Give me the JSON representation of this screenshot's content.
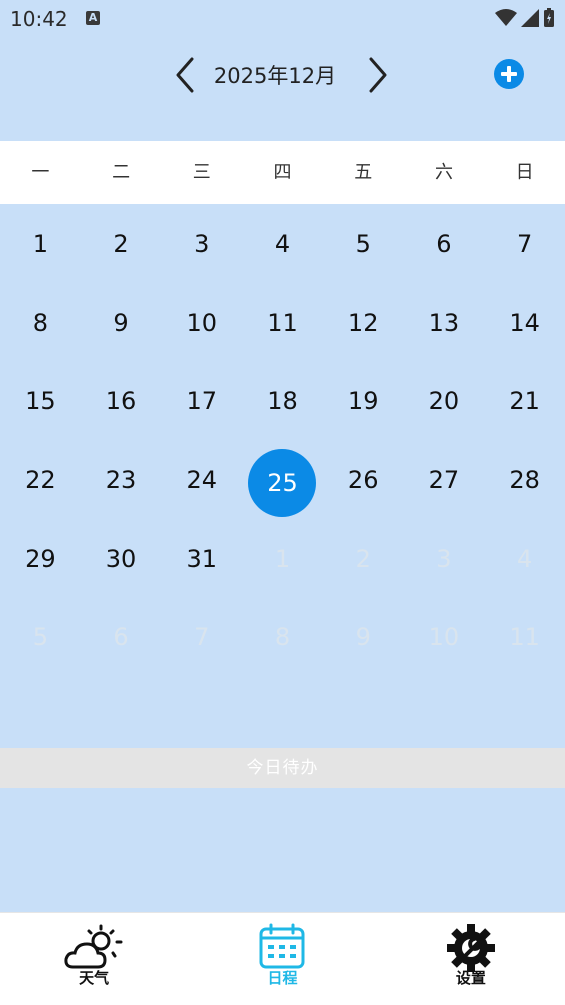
{
  "status": {
    "time": "10:42",
    "notif_letter": "A"
  },
  "header": {
    "title": "2025年12月"
  },
  "weekdays": [
    "一",
    "二",
    "三",
    "四",
    "五",
    "六",
    "日"
  ],
  "calendar": {
    "days": [
      {
        "n": "1",
        "o": false
      },
      {
        "n": "2",
        "o": false
      },
      {
        "n": "3",
        "o": false
      },
      {
        "n": "4",
        "o": false
      },
      {
        "n": "5",
        "o": false
      },
      {
        "n": "6",
        "o": false
      },
      {
        "n": "7",
        "o": false
      },
      {
        "n": "8",
        "o": false
      },
      {
        "n": "9",
        "o": false
      },
      {
        "n": "10",
        "o": false
      },
      {
        "n": "11",
        "o": false
      },
      {
        "n": "12",
        "o": false
      },
      {
        "n": "13",
        "o": false
      },
      {
        "n": "14",
        "o": false
      },
      {
        "n": "15",
        "o": false
      },
      {
        "n": "16",
        "o": false
      },
      {
        "n": "17",
        "o": false
      },
      {
        "n": "18",
        "o": false
      },
      {
        "n": "19",
        "o": false
      },
      {
        "n": "20",
        "o": false
      },
      {
        "n": "21",
        "o": false
      },
      {
        "n": "22",
        "o": false
      },
      {
        "n": "23",
        "o": false
      },
      {
        "n": "24",
        "o": false
      },
      {
        "n": "25",
        "o": false,
        "selected": true
      },
      {
        "n": "26",
        "o": false
      },
      {
        "n": "27",
        "o": false
      },
      {
        "n": "28",
        "o": false
      },
      {
        "n": "29",
        "o": false
      },
      {
        "n": "30",
        "o": false
      },
      {
        "n": "31",
        "o": false
      },
      {
        "n": "1",
        "o": true
      },
      {
        "n": "2",
        "o": true
      },
      {
        "n": "3",
        "o": true
      },
      {
        "n": "4",
        "o": true
      },
      {
        "n": "5",
        "o": true
      },
      {
        "n": "6",
        "o": true
      },
      {
        "n": "7",
        "o": true
      },
      {
        "n": "8",
        "o": true
      },
      {
        "n": "9",
        "o": true
      },
      {
        "n": "10",
        "o": true
      },
      {
        "n": "11",
        "o": true
      }
    ]
  },
  "todo": {
    "label": "今日待办"
  },
  "nav": {
    "weather": "天气",
    "schedule": "日程",
    "settings": "设置"
  },
  "colors": {
    "accent": "#0b8ae6",
    "background": "#c8dff8",
    "active_tab": "#1fb8e6"
  }
}
